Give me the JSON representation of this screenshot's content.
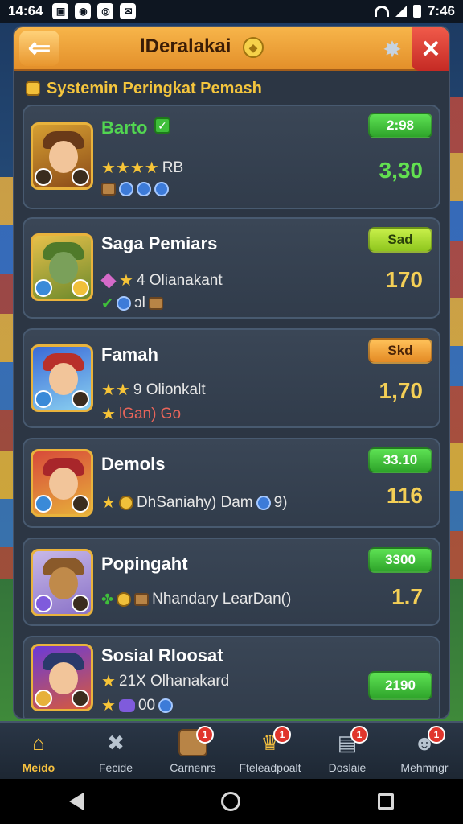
{
  "status_bar": {
    "time_left": "14:64",
    "time_right": "7:46"
  },
  "header": {
    "back_icon": "left-arrow-icon",
    "title": "lDeralakai",
    "close_icon": "close-icon",
    "settings_icon": "gear-star-icon"
  },
  "section": {
    "title": "Systemin Peringkat Pemash"
  },
  "rows": [
    {
      "name": "Barto",
      "stat": "RB",
      "pill": "2:98",
      "score": "3,30",
      "pill_color": "green"
    },
    {
      "name": "Saga Pemiars",
      "stat": "4 Olianakant",
      "sub": "ɔl",
      "pill": "Sad",
      "score": "170",
      "pill_color": "lime"
    },
    {
      "name": "Famah",
      "stat": "9 Olionkalt",
      "sub": "lGan) Go",
      "pill": "Skd",
      "score": "1,70",
      "pill_color": "orange"
    },
    {
      "name": "Demols",
      "stat": "DhSaniahy) Dam",
      "stat_tail": "9)",
      "pill": "33.10",
      "score": "116",
      "pill_color": "green"
    },
    {
      "name": "Popingaht",
      "stat": "Nhandary LearDan()",
      "pill": "3300",
      "score": "1.7",
      "pill_color": "green"
    },
    {
      "name": "Sosial Rloosat",
      "stat": "21X Olhanakard",
      "sub": "00",
      "pill": "2190",
      "pill_color": "green"
    }
  ],
  "nav": [
    {
      "label": "Meido",
      "icon": "home-icon",
      "active": true
    },
    {
      "label": "Fecide",
      "icon": "tools-icon"
    },
    {
      "label": "Carnenrs",
      "icon": "chest-icon",
      "badge": "1"
    },
    {
      "label": "Fteleadpoalt",
      "icon": "trophy-icon",
      "badge": "1"
    },
    {
      "label": "Doslaie",
      "icon": "clipboard-icon",
      "badge": "1"
    },
    {
      "label": "Mehmngr",
      "icon": "profile-icon",
      "badge": "1"
    }
  ]
}
